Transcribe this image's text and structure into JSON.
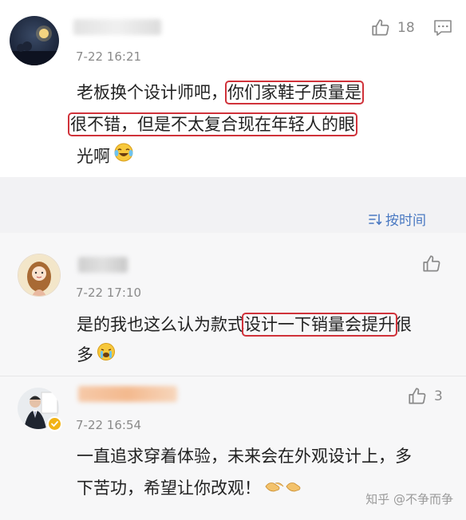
{
  "comments": [
    {
      "time": "7-22 16:21",
      "like_count": "18",
      "text_plain_1": "老板换个设计师吧，",
      "text_hl_1": "你们家鞋子质量是",
      "text_hl_2": "很不错，但是不太复合现在年轻人的眼",
      "text_plain_2": "光啊",
      "emoji": "laugh-cry-emoji"
    },
    {
      "time": "7-22 17:10",
      "text_plain_1": "是的我也这么认为款式",
      "text_hl_1": "设计一下销量会提升",
      "text_plain_2": "很",
      "text_plain_3": "多",
      "emoji": "crying-emoji"
    },
    {
      "time": "7-22 16:54",
      "like_count": "3",
      "text_line_1": "一直追求穿着体验，未来会在外观设计上，多",
      "text_line_2": "下苦功，希望让你改观！",
      "emoji": "handshake-emoji"
    }
  ],
  "sort": {
    "label": "按时间"
  },
  "watermark": {
    "text": "知乎 @不争而争"
  },
  "colors": {
    "highlight": "#d0323a",
    "link": "#4a79c2",
    "muted": "#8a8a8a"
  }
}
